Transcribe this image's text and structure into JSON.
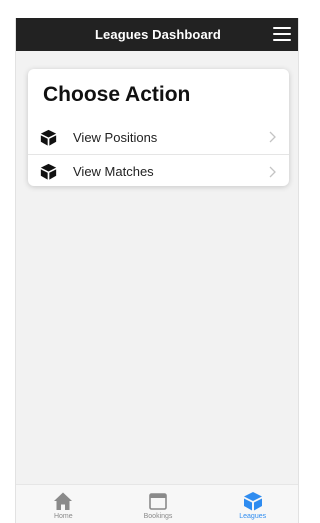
{
  "header": {
    "title": "Leagues Dashboard",
    "menu_icon": "hamburger-menu-icon"
  },
  "card": {
    "title": "Choose Action",
    "items": [
      {
        "label": "View Positions",
        "icon": "cube-icon"
      },
      {
        "label": "View Matches",
        "icon": "cube-icon"
      }
    ]
  },
  "tabbar": {
    "tabs": [
      {
        "label": "Home",
        "icon": "home-icon",
        "active": false
      },
      {
        "label": "Bookings",
        "icon": "calendar-icon",
        "active": false
      },
      {
        "label": "Leagues",
        "icon": "cube-icon",
        "active": true
      }
    ]
  },
  "colors": {
    "header_bg": "#222222",
    "accent": "#2f8cf0",
    "inactive": "#8a8a8a",
    "page_bg": "#f2f2f2"
  }
}
